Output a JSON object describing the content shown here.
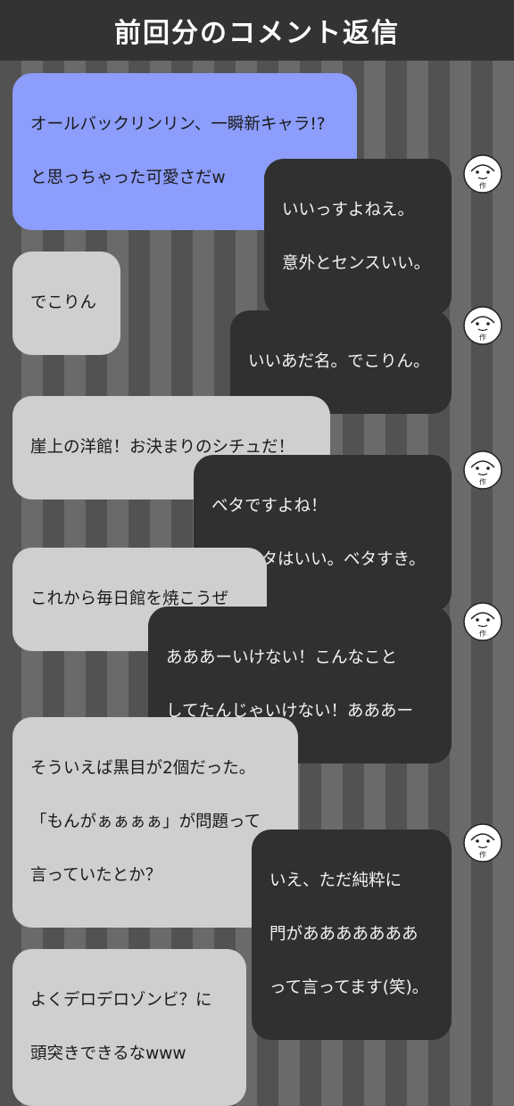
{
  "header": {
    "title": "前回分のコメント返信"
  },
  "colors": {
    "user_bubble_first": "#8c9dfb",
    "user_bubble": "#cfcfcf",
    "author_bubble": "#303030",
    "header_bg": "#333333"
  },
  "avatar_icon": "author-face-icon",
  "avatar_label": "作",
  "messages": [
    {
      "side": "left",
      "lines": [
        "オールバックリンリン、一瞬新キャラ!?",
        "と思っちゃった可愛さだw"
      ]
    },
    {
      "side": "right",
      "lines": [
        "いいっすよねえ。",
        "意外とセンスいい。"
      ]
    },
    {
      "side": "left",
      "lines": [
        "でこりん"
      ]
    },
    {
      "side": "right",
      "lines": [
        "いいあだ名。でこりん。"
      ]
    },
    {
      "side": "left",
      "lines": [
        "崖上の洋館！お決まりのシチュだ！"
      ]
    },
    {
      "side": "right",
      "lines": [
        "ベタですよね！",
        "でもベタはいい。ベタすき。"
      ]
    },
    {
      "side": "left",
      "lines": [
        "これから毎日館を焼こうぜ"
      ]
    },
    {
      "side": "right",
      "lines": [
        "あああーいけない！こんなこと",
        "してたんじゃいけない！あああー"
      ]
    },
    {
      "side": "left",
      "lines": [
        "そういえば黒目が2個だった。",
        "「もんがぁぁぁぁ」が問題って",
        "言っていたとか？"
      ]
    },
    {
      "side": "right",
      "lines": [
        "いえ、ただ純粋に",
        "門があああああああ",
        "って言ってます(笑)。"
      ]
    },
    {
      "side": "left",
      "lines": [
        "よくデロデロゾンビ？に",
        "頭突きできるなwww"
      ]
    }
  ]
}
